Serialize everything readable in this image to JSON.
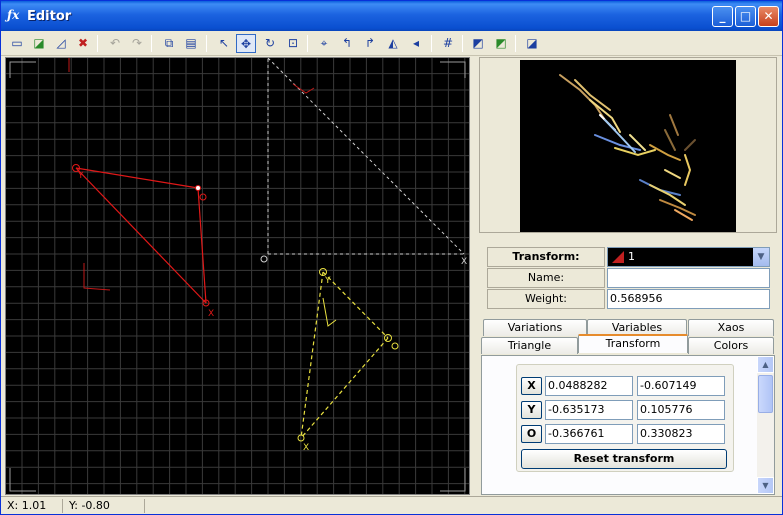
{
  "window": {
    "title": "Editor",
    "app_icon": "ƒx"
  },
  "title_buttons": {
    "minimize": "_",
    "maximize": "□",
    "close": "✕"
  },
  "toolbar": {
    "icons": [
      "new-icon",
      "add-transform-icon",
      "duplicate-icon",
      "delete-icon",
      "undo-icon",
      "redo-icon",
      "copy-icon",
      "paste-icon",
      "select-icon",
      "move-icon",
      "rotate-icon",
      "scale-icon",
      "pivot-icon",
      "rotate-left-icon",
      "rotate-right-icon",
      "flip-horizontal-icon",
      "flip-vertical-icon",
      "grid-icon",
      "reset-icon",
      "variation-icon",
      "post-transform-icon"
    ]
  },
  "canvas": {
    "colors": {
      "grid": "#3a3a3a",
      "red": "#e01818",
      "yellow": "#e8e040",
      "reference": "#cfcfcf"
    }
  },
  "properties": {
    "transform_label": "Transform:",
    "transform_value": "1",
    "name_label": "Name:",
    "name_value": "",
    "weight_label": "Weight:",
    "weight_value": "0.568956"
  },
  "tabs": {
    "row1": [
      "Variations",
      "Variables",
      "Xaos"
    ],
    "row2": [
      "Triangle",
      "Transform",
      "Colors"
    ],
    "active": "Transform"
  },
  "transform": {
    "x_label": "X",
    "x1": "0.0488282",
    "x2": "-0.607149",
    "y_label": "Y",
    "y1": "-0.635173",
    "y2": "0.105776",
    "o_label": "O",
    "o1": "-0.366761",
    "o2": "0.330823",
    "reset_label": "Reset transform"
  },
  "status": {
    "x": "X: 1.01",
    "y": "Y: -0.80"
  }
}
